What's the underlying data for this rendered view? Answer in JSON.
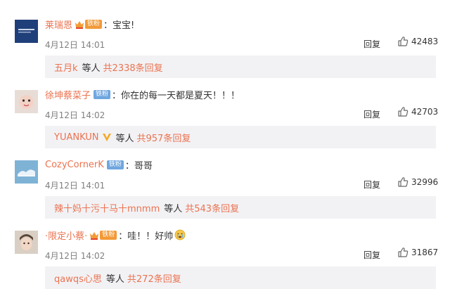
{
  "comments": [
    {
      "username": "莱瑞恩",
      "badge": "铁粉",
      "badge_color": "#f29a38",
      "text": "：宝宝!",
      "time": "4月12日 14:01",
      "reply_label": "回复",
      "likes": "42483",
      "sub_user": "五月k",
      "sub_mid": "等人",
      "sub_count": "共2338条回复"
    },
    {
      "username": "徐坤蔡菜子",
      "badge": "铁粉",
      "badge_color": "#6fa6df",
      "text": "：你在的每一天都是夏天！！！",
      "time": "4月12日 14:02",
      "reply_label": "回复",
      "likes": "42703",
      "sub_user": "YUANKUN",
      "sub_mid": "等人",
      "sub_count": "共957条回复"
    },
    {
      "username": "CozyCornerK",
      "badge": "铁粉",
      "badge_color": "#6fa6df",
      "text": "：哥哥",
      "time": "4月12日 14:01",
      "reply_label": "回复",
      "likes": "32996",
      "sub_user": "辣十妈十污十马十mnmm",
      "sub_mid": "等人",
      "sub_count": "共543条回复"
    },
    {
      "username": "·限定小蔡·",
      "badge": "铁粉",
      "badge_color": "#f29a38",
      "text": "：哇！！好帅",
      "time": "4月12日 14:02",
      "reply_label": "回复",
      "likes": "31867",
      "sub_user": "qawqs心思",
      "sub_mid": "等人",
      "sub_count": "共272条回复"
    }
  ],
  "colors": {
    "username": "#eb7350",
    "subbox": "#f2f2f5",
    "meta": "#808080"
  }
}
